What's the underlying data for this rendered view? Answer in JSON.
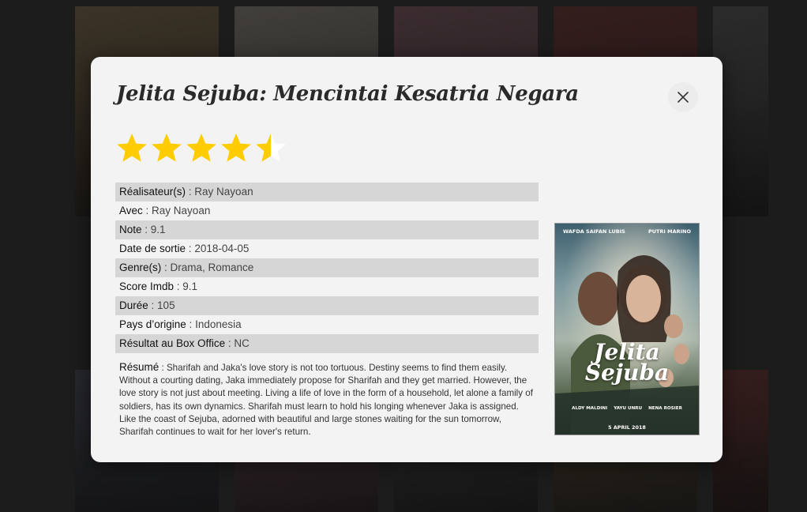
{
  "movie": {
    "title": "Jelita Sejuba: Mencintai Kesatria Negara",
    "rating_stars": 4.5,
    "rating_max": 5,
    "star_color": "#ffcc00",
    "details": [
      {
        "key": "Réalisateur(s)",
        "value": "Ray Nayoan"
      },
      {
        "key": "Avec",
        "value": "Ray Nayoan"
      },
      {
        "key": "Note",
        "value": "9.1"
      },
      {
        "key": "Date de sortie",
        "value": "2018-04-05"
      },
      {
        "key": "Genre(s)",
        "value": "Drama, Romance"
      },
      {
        "key": "Score Imdb",
        "value": "9.1"
      },
      {
        "key": "Durée",
        "value": "105"
      },
      {
        "key": "Pays d’origine",
        "value": "Indonesia"
      },
      {
        "key": "Résultat au Box Office",
        "value": "NC"
      }
    ],
    "separator": " : ",
    "resume_label": "Résumé",
    "resume_text": "Sharifah and Jaka's love story is not too tortuous. Destiny seems to find them easily. Without a courting dating, Jaka immediately propose for Sharifah and they get married. However, the love story is not just about meeting. Living a life of love in the form of a household, let alone a family of soldiers, has its own dynamics. Sharifah must learn to hold his longing whenever Jaka is assigned. Like the coast of Sejuba, adorned with beautiful and large stones waiting for the sun tomorrow, Sharifah continues to wait for her lover's return.",
    "poster": {
      "actor_left": "WAFDA SAIFAN LUBIS",
      "actor_right": "PUTRI MARINO",
      "title_line1": "Jelita",
      "title_line2": "Sejuba",
      "cast": [
        "ALDY MALDINI",
        "YAYU UNRU",
        "NENA ROSIER"
      ],
      "date": "5 APRIL 2018"
    }
  },
  "close_icon": "close-icon"
}
